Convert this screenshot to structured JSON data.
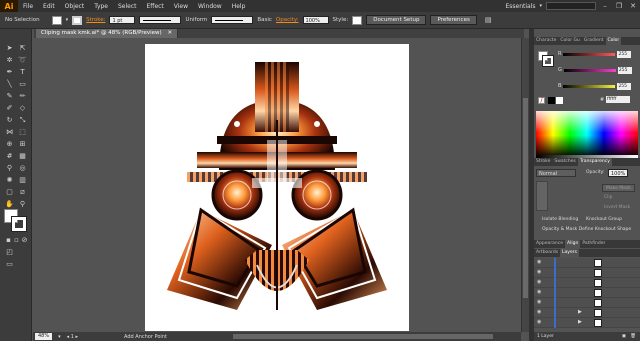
{
  "app": {
    "logo": "Ai"
  },
  "menubar": {
    "items": [
      "File",
      "Edit",
      "Object",
      "Type",
      "Select",
      "Effect",
      "View",
      "Window",
      "Help"
    ],
    "workspace": "Essentials"
  },
  "controlbar": {
    "selection": "No Selection",
    "stroke_label": "Stroke:",
    "stroke_weight": "1 pt",
    "uniform": "Uniform",
    "basic": "Basic",
    "opacity_label": "Opacity:",
    "opacity_value": "100%",
    "style_label": "Style:",
    "document_setup": "Document Setup",
    "preferences": "Preferences"
  },
  "document": {
    "tab_title": "Cliping mask kmk.ai* @ 48% (RGB/Preview)"
  },
  "statusbar": {
    "zoom": "48%",
    "tool_status": "Add Anchor Point"
  },
  "panels": {
    "color_tabs": [
      "Characte",
      "Color Gu",
      "Gradient",
      "Color"
    ],
    "color_rows": [
      {
        "label": "R",
        "value": "255",
        "color": "#ff5a5a"
      },
      {
        "label": "G",
        "value": "255",
        "color": "#ff3ecf"
      },
      {
        "label": "B",
        "value": "255",
        "color": "#f4f23b"
      }
    ],
    "hex_value": "ffffff",
    "transparency_tabs": [
      "Stroke",
      "Swatches",
      "Transparency"
    ],
    "blend_mode": "Normal",
    "opacity_label": "Opacity:",
    "opacity_value": "100%",
    "make_mask": "Make Mask",
    "clip": "Clip",
    "invert_mask": "Invert Mask",
    "isolate_blending": "Isolate Blending",
    "knockout_group": "Knockout Group",
    "opacity_mask": "Opacity & Mask Define Knockout Shape",
    "align_tabs": [
      "Appearance",
      "Align",
      "Pathfinder"
    ],
    "layer_tabs": [
      "Artboards",
      "Layers"
    ],
    "layer_count": "1 Layer"
  },
  "colors": {
    "accent": "#f28a1c",
    "ui_dark": "#3c3c3c",
    "canvas_bg": "#535353",
    "layer_color": "#3b6cc9"
  }
}
